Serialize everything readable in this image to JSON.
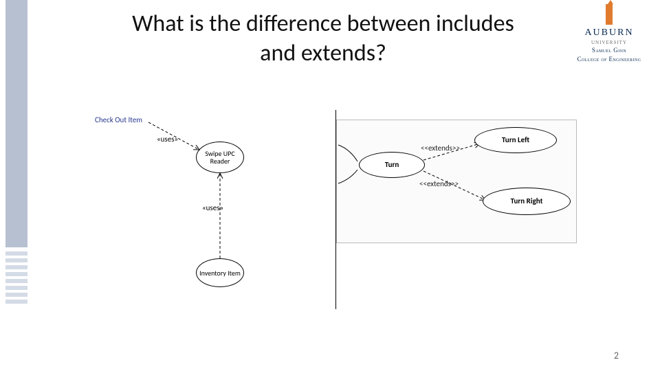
{
  "slide": {
    "title": "What is the difference between includes and extends?",
    "page_number": "2"
  },
  "branding": {
    "brand": "AUBURN",
    "unit": "UNIVERSITY",
    "college_line1": "Samuel Ginn",
    "college_line2": "College of Engineering"
  },
  "left_diagram": {
    "start_label": "Check Out Item",
    "stereotype_uses": "«uses»",
    "node_swipe": "Swipe UPC Reader",
    "node_inventory": "Inventory Item"
  },
  "right_diagram": {
    "stereotype_extends": "<<extends>>",
    "node_turn": "Turn",
    "node_turn_left": "Turn Left",
    "node_turn_right": "Turn Right"
  }
}
